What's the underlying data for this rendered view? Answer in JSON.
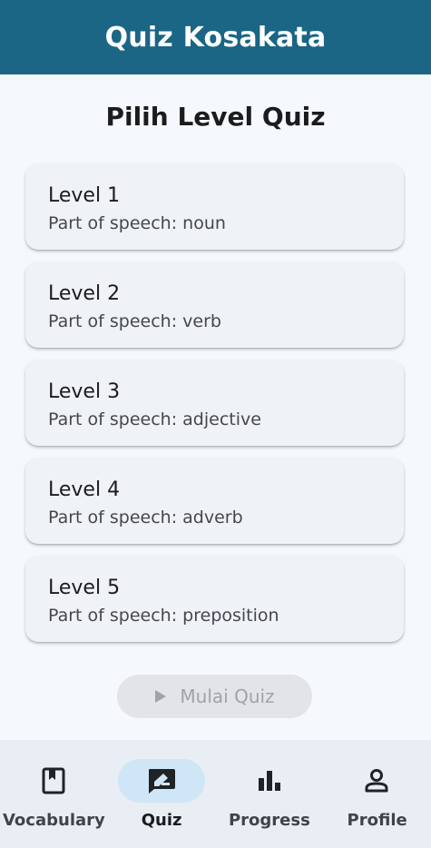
{
  "app_bar": {
    "title": "Quiz Kosakata"
  },
  "page": {
    "title": "Pilih Level Quiz"
  },
  "levels": [
    {
      "name": "Level 1",
      "pos": "Part of speech: noun"
    },
    {
      "name": "Level 2",
      "pos": "Part of speech: verb"
    },
    {
      "name": "Level 3",
      "pos": "Part of speech: adjective"
    },
    {
      "name": "Level 4",
      "pos": "Part of speech: adverb"
    },
    {
      "name": "Level 5",
      "pos": "Part of speech: preposition"
    }
  ],
  "start_button": {
    "label": "Mulai Quiz",
    "icon": "play-icon",
    "state": "disabled"
  },
  "bottom_nav": {
    "items": [
      {
        "label": "Vocabulary",
        "icon": "book-icon",
        "active": false
      },
      {
        "label": "Quiz",
        "icon": "quiz-edit-icon",
        "active": true
      },
      {
        "label": "Progress",
        "icon": "bar-chart-icon",
        "active": false
      },
      {
        "label": "Profile",
        "icon": "person-icon",
        "active": false
      }
    ]
  },
  "colors": {
    "app_bar": "#1b6585",
    "background": "#f5f9fd",
    "card": "#eff2f7",
    "nav_bar": "#e8eef4",
    "nav_active_pill": "#cfe6f6"
  }
}
